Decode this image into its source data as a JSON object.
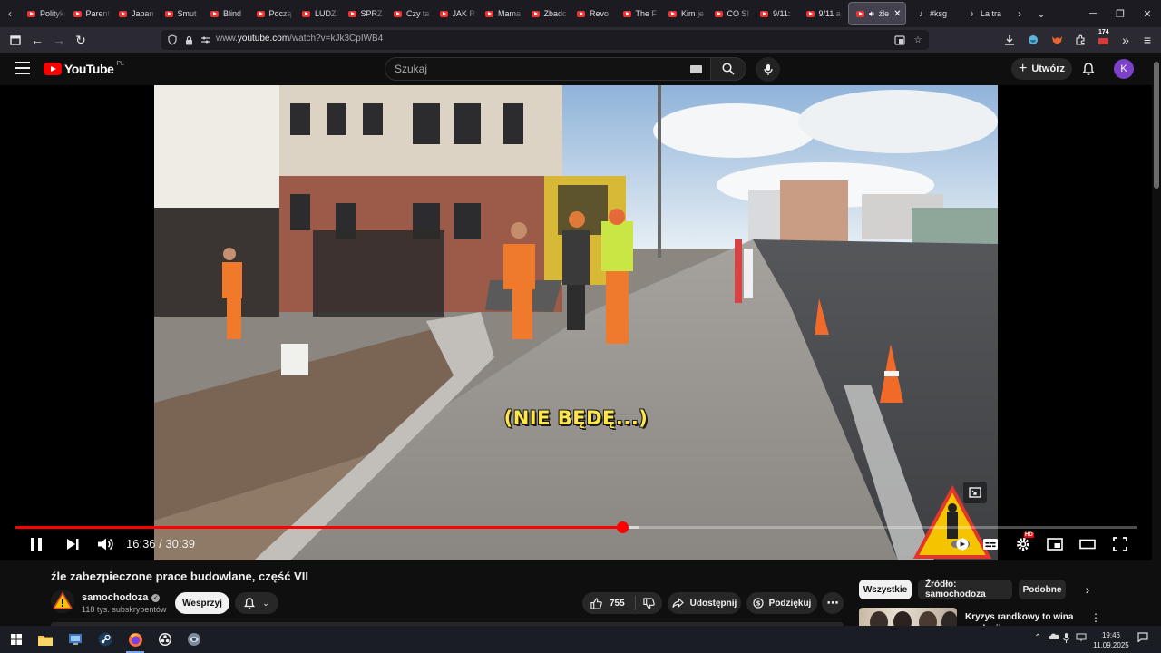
{
  "browser": {
    "tabs": [
      {
        "title": "Polityka",
        "favicon": "youtube"
      },
      {
        "title": "Parent",
        "favicon": "youtube"
      },
      {
        "title": "Japan",
        "favicon": "youtube"
      },
      {
        "title": "Smut",
        "favicon": "youtube"
      },
      {
        "title": "Blind",
        "favicon": "youtube"
      },
      {
        "title": "Począ",
        "favicon": "youtube"
      },
      {
        "title": "LUDZI",
        "favicon": "youtube"
      },
      {
        "title": "SPRZ",
        "favicon": "youtube"
      },
      {
        "title": "Czy ta",
        "favicon": "youtube"
      },
      {
        "title": "JAK R",
        "favicon": "youtube"
      },
      {
        "title": "Mama",
        "favicon": "youtube"
      },
      {
        "title": "Zbadc",
        "favicon": "youtube"
      },
      {
        "title": "Revo",
        "favicon": "youtube"
      },
      {
        "title": "The F",
        "favicon": "youtube"
      },
      {
        "title": "Kim je",
        "favicon": "youtube"
      },
      {
        "title": "CO SI",
        "favicon": "youtube"
      },
      {
        "title": "9/11:",
        "favicon": "youtube"
      },
      {
        "title": "9/11 a",
        "favicon": "youtube"
      }
    ],
    "active_tab": {
      "title": "źle",
      "favicon": "youtube",
      "audio": "speaker-icon"
    },
    "after_tabs": [
      {
        "title": "#ksg",
        "favicon": "tiktok"
      },
      {
        "title": "La tra",
        "favicon": "tiktok"
      }
    ],
    "url": {
      "prefix": "www.",
      "domain": "youtube.com",
      "path": "/watch?v=kJk3CpIWB4"
    },
    "extension_badge": "174"
  },
  "youtube": {
    "logo_text": "YouTube",
    "country_code": "PL",
    "search_placeholder": "Szukaj",
    "create_label": "Utwórz",
    "avatar_letter": "K",
    "accent_color": "#ff0000"
  },
  "player": {
    "subtitle": "(NIE BĘDĘ...)",
    "current_time": "16:36",
    "duration": "30:39",
    "progress_fraction": 0.5416,
    "buffered_fraction": 0.556,
    "hd_badge": "HD"
  },
  "video": {
    "title": "źle zabezpieczone prace budowlane, część VII",
    "channel": "samochodoza",
    "subscribers": "118 tys. subskrybentów",
    "join_label": "Wesprzyj",
    "likes": "755",
    "share_label": "Udostępnij",
    "thanks_label": "Podziękuj"
  },
  "sidebar": {
    "chips": [
      "Wszystkie",
      "Źródło: samochodoza",
      "Podobne"
    ],
    "active_chip": 0,
    "recommendation_title": "Kryzys randkowy to wina ewolucji"
  },
  "taskbar": {
    "time": "19:46",
    "date": "11.09.2025"
  }
}
